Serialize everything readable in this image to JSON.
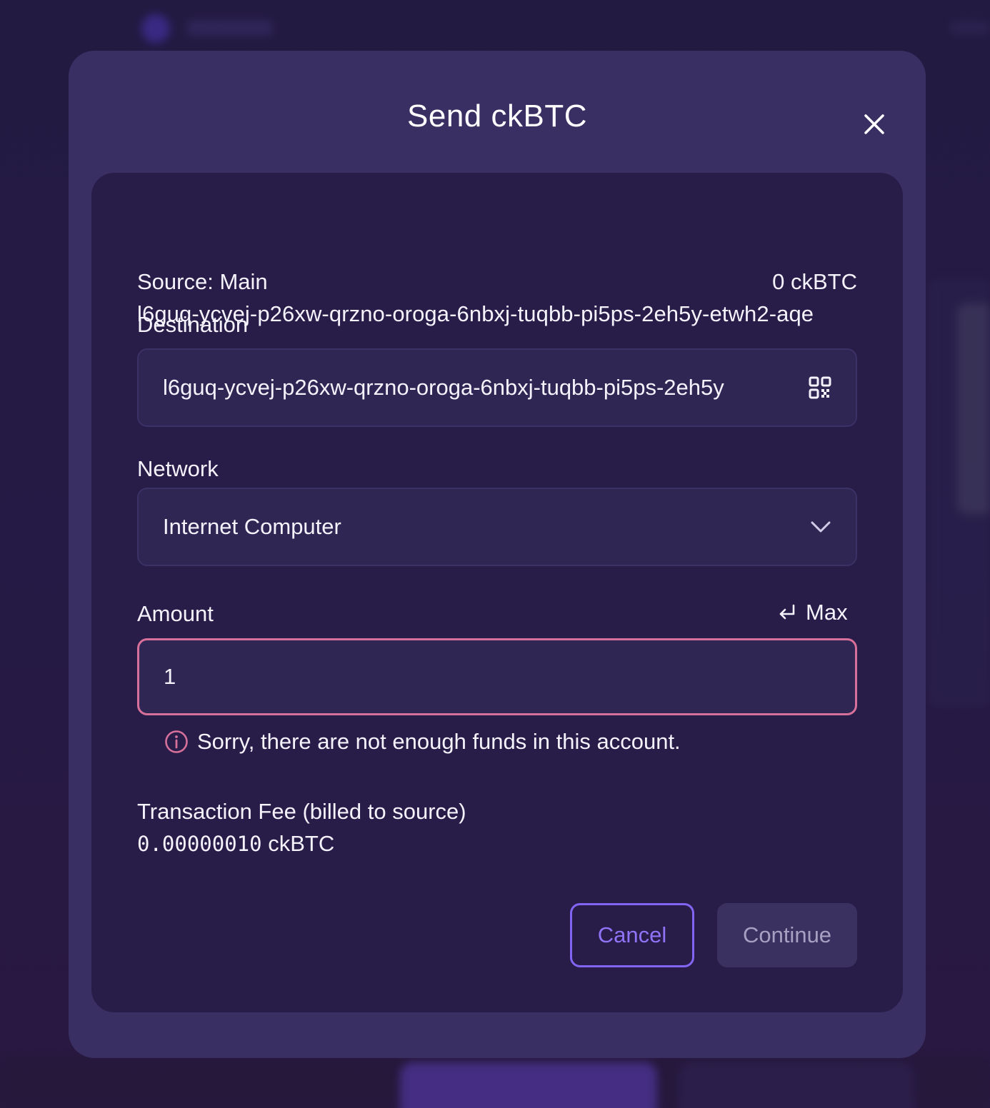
{
  "background": {
    "description_colors": {
      "page": "#241a45",
      "accent": "#5a3fb8"
    }
  },
  "modal": {
    "title": "Send ckBTC",
    "close_icon": "close-icon",
    "source": {
      "label": "Source: Main",
      "balance": "0 ckBTC",
      "address": "l6guq-ycvej-p26xw-qrzno-oroga-6nbxj-tuqbb-pi5ps-2eh5y-etwh2-aqe"
    },
    "destination": {
      "label": "Destination",
      "value": "l6guq-ycvej-p26xw-qrzno-oroga-6nbxj-tuqbb-pi5ps-2eh5y",
      "icon": "qr-code-icon"
    },
    "network": {
      "label": "Network",
      "selected": "Internet Computer",
      "icon": "chevron-down-icon"
    },
    "amount": {
      "label": "Amount",
      "max_label": "Max",
      "max_icon": "return-arrow-icon",
      "value": "1",
      "error": "Sorry, there are not enough funds in this account.",
      "error_icon": "info-icon",
      "error_color": "#d7709a"
    },
    "fee": {
      "label": "Transaction Fee (billed to source)",
      "amount": "0.00000010",
      "unit": "ckBTC"
    },
    "buttons": {
      "cancel": "Cancel",
      "continue": "Continue"
    }
  }
}
